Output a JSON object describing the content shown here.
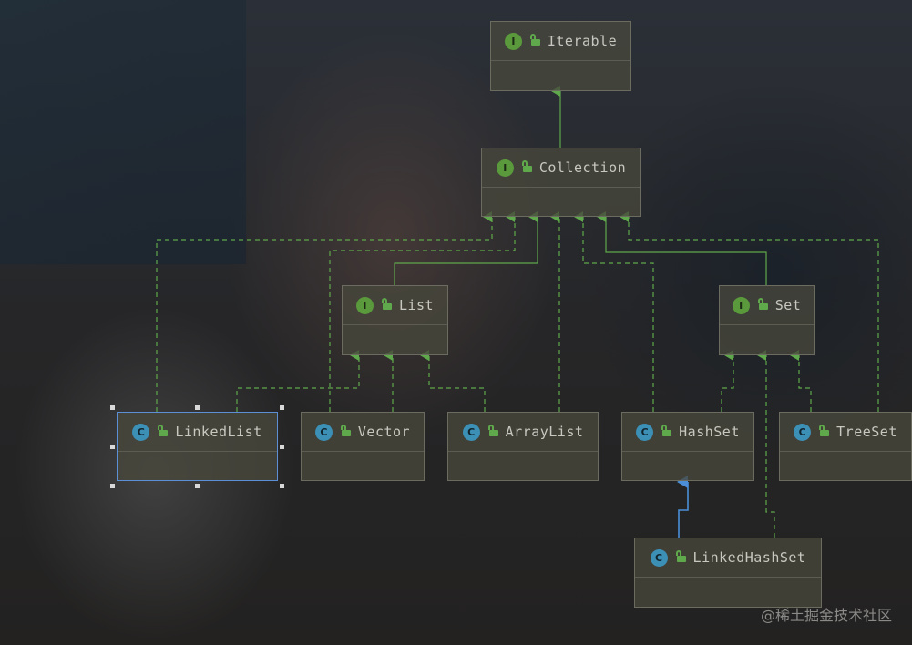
{
  "nodes": {
    "iterable": {
      "name": "Iterable",
      "kind": "I"
    },
    "collection": {
      "name": "Collection",
      "kind": "I"
    },
    "list": {
      "name": "List",
      "kind": "I"
    },
    "set": {
      "name": "Set",
      "kind": "I"
    },
    "linkedlist": {
      "name": "LinkedList",
      "kind": "C"
    },
    "vector": {
      "name": "Vector",
      "kind": "C"
    },
    "arraylist": {
      "name": "ArrayList",
      "kind": "C"
    },
    "hashset": {
      "name": "HashSet",
      "kind": "C"
    },
    "treeset": {
      "name": "TreeSet",
      "kind": "C"
    },
    "linkedhashset": {
      "name": "LinkedHashSet",
      "kind": "C"
    }
  },
  "watermark": "@稀土掘金技术社区",
  "colors": {
    "interface_badge": "#5a9a3c",
    "class_badge": "#3c8fb5",
    "extends_line": "#5fa84b",
    "implements_line": "#5fa84b",
    "class_extends_line": "#4a8fd8",
    "selection": "#5c8fd6"
  }
}
